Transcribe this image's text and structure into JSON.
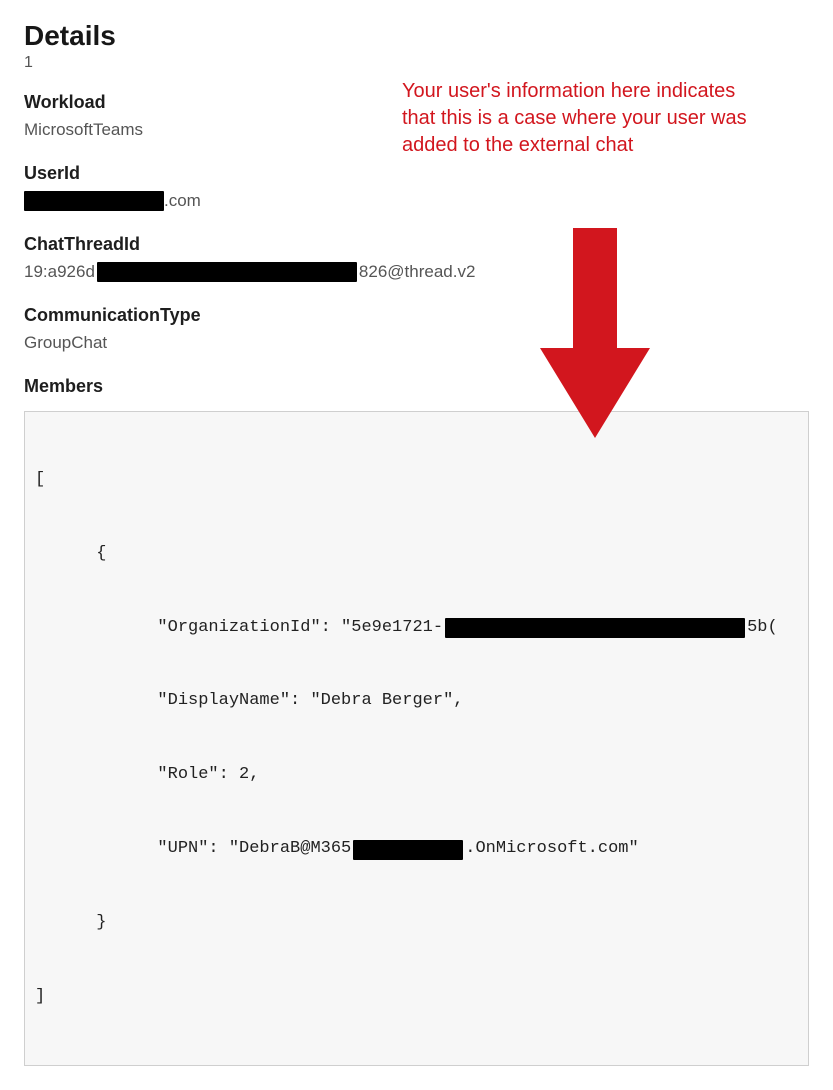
{
  "header": {
    "title": "Details",
    "count": "1"
  },
  "annotation": {
    "text": "Your user's information here indicates that this is a case where your user was added to the external chat",
    "color": "#d2161e"
  },
  "fields": {
    "workload": {
      "label": "Workload",
      "value": "MicrosoftTeams"
    },
    "userId": {
      "label": "UserId",
      "prefix": "",
      "suffix": ".com"
    },
    "chatThread": {
      "label": "ChatThreadId",
      "prefix": "19:a926d",
      "suffix": "826@thread.v2"
    },
    "commType": {
      "label": "CommunicationType",
      "value": "GroupChat"
    },
    "members": {
      "label": "Members"
    }
  },
  "code": {
    "open_array": "[",
    "open_obj": "      {",
    "org_key": "            \"OrganizationId\": \"5e9e1721-",
    "org_tail": "5b(",
    "display": "            \"DisplayName\": \"Debra Berger\",",
    "role": "            \"Role\": 2,",
    "upn_pre": "            \"UPN\": \"DebraB@M365",
    "upn_post": ".OnMicrosoft.com\"",
    "close_obj": "      }",
    "close_array": "]"
  }
}
